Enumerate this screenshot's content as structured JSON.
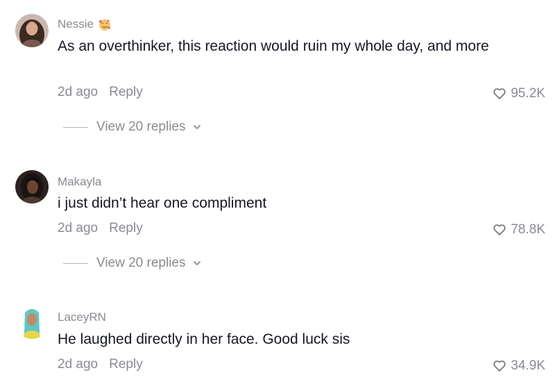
{
  "comments": [
    {
      "username": "Nessie",
      "username_emoji": "smiling-face-with-hearts-emoji",
      "text": "As an overthinker, this reaction would ruin my whole day, and more",
      "time": "2d ago",
      "reply_label": "Reply",
      "likes": "95.2K",
      "view_replies": "View 20 replies"
    },
    {
      "username": "Makayla",
      "text": "i just didn’t hear one compliment",
      "time": "2d ago",
      "reply_label": "Reply",
      "likes": "78.8K",
      "view_replies": "View 20 replies"
    },
    {
      "username": "LaceyRN",
      "text": "He laughed directly in her face. Good luck sis",
      "time": "2d ago",
      "reply_label": "Reply",
      "likes": "34.9K"
    }
  ],
  "icons": {
    "like": "heart-outline-icon",
    "expand": "chevron-down-icon"
  },
  "colors": {
    "text_primary": "#161823",
    "text_secondary": "#8a8b91",
    "background": "#ffffff"
  }
}
